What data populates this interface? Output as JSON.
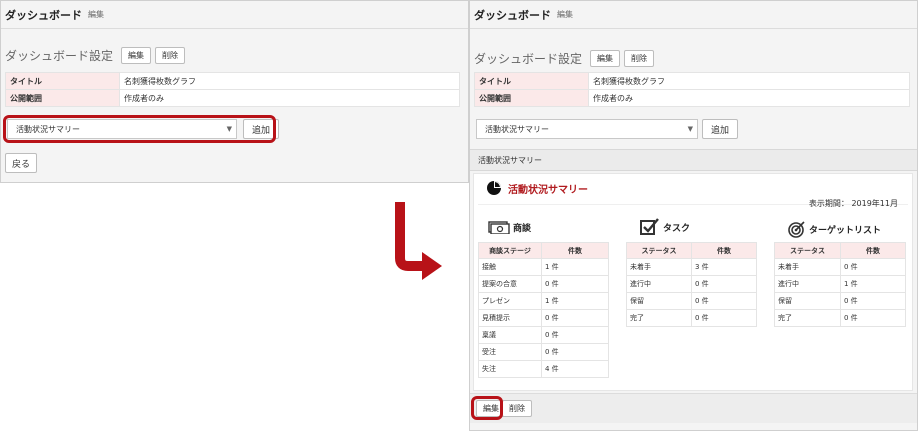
{
  "left_panel": {
    "header": {
      "title": "ダッシュボード",
      "subtitle": "編集"
    },
    "settings": {
      "title": "ダッシュボード設定",
      "edit_label": "編集",
      "delete_label": "削除"
    },
    "info": [
      {
        "label": "タイトル",
        "value": "名刺獲得枚数グラフ"
      },
      {
        "label": "公開範囲",
        "value": "作成者のみ"
      }
    ],
    "select_value": "活動状況サマリー",
    "add_label": "追加",
    "back_label": "戻る"
  },
  "right_panel": {
    "header": {
      "title": "ダッシュボード",
      "subtitle": "編集"
    },
    "settings": {
      "title": "ダッシュボード設定",
      "edit_label": "編集",
      "delete_label": "削除"
    },
    "info": [
      {
        "label": "タイトル",
        "value": "名刺獲得枚数グラフ"
      },
      {
        "label": "公開範囲",
        "value": "作成者のみ"
      }
    ],
    "select_value": "活動状況サマリー",
    "add_label": "追加",
    "summary_bar_label": "活動状況サマリー",
    "card": {
      "title": "活動状況サマリー",
      "period": "表示期間： 2019年11月",
      "sections": [
        {
          "title": "商談",
          "icon": "money-icon",
          "headers": [
            "商談ステージ",
            "件数"
          ],
          "rows": [
            [
              "接触",
              "1 件"
            ],
            [
              "提案の合意",
              "0 件"
            ],
            [
              "プレゼン",
              "1 件"
            ],
            [
              "見積提示",
              "0 件"
            ],
            [
              "稟議",
              "0 件"
            ],
            [
              "受注",
              "0 件"
            ],
            [
              "失注",
              "4 件"
            ]
          ]
        },
        {
          "title": "タスク",
          "icon": "checkbox-icon",
          "headers": [
            "ステータス",
            "件数"
          ],
          "rows": [
            [
              "未着手",
              "3 件"
            ],
            [
              "進行中",
              "0 件"
            ],
            [
              "保留",
              "0 件"
            ],
            [
              "完了",
              "0 件"
            ]
          ]
        },
        {
          "title": "ターゲットリスト",
          "icon": "target-icon",
          "headers": [
            "ステータス",
            "件数"
          ],
          "rows": [
            [
              "未着手",
              "0 件"
            ],
            [
              "進行中",
              "1 件"
            ],
            [
              "保留",
              "0 件"
            ],
            [
              "完了",
              "0 件"
            ]
          ]
        }
      ]
    },
    "bottom": {
      "edit_label": "編集",
      "delete_label": "削除"
    }
  },
  "colors": {
    "accent": "#b81218",
    "table_header_bg": "#fbe9e9",
    "card_title": "#b11b1f"
  }
}
